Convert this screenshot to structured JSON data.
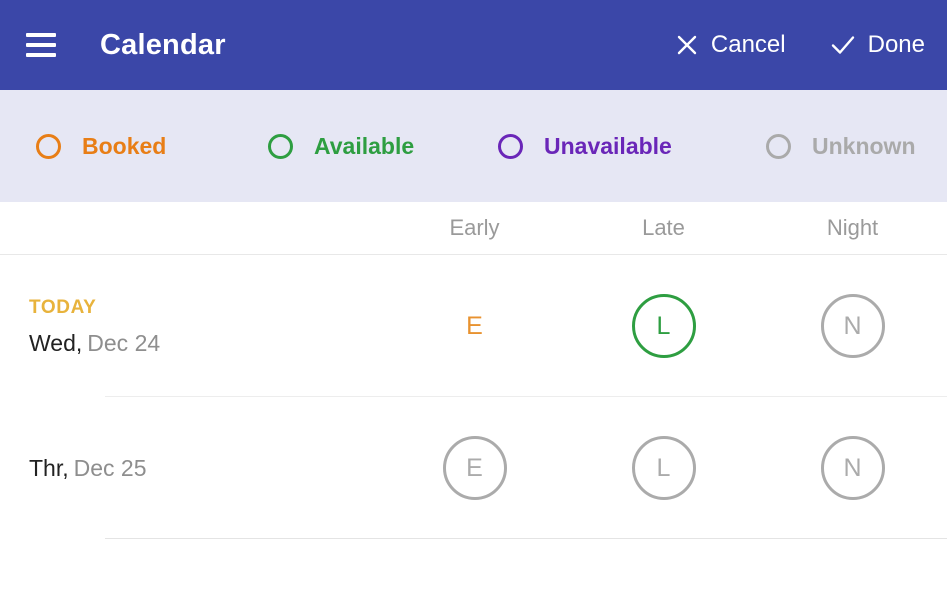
{
  "appbar": {
    "menu_icon": "hamburger-menu-icon",
    "title": "Calendar",
    "cancel": {
      "icon": "close-x-icon",
      "glyph": "✕",
      "label": "Cancel"
    },
    "done": {
      "icon": "checkmark-icon",
      "glyph": "✓",
      "label": "Done"
    },
    "background_color": "#3B47A8",
    "text_color": "#FFFFFF"
  },
  "legend": {
    "background_color": "#E6E7F4",
    "items": [
      {
        "label": "Booked",
        "color": "#E87E16",
        "icon": "status-circle-icon"
      },
      {
        "label": "Available",
        "color": "#2E9E41",
        "icon": "status-circle-icon"
      },
      {
        "label": "Unavailable",
        "color": "#6A26B8",
        "icon": "status-circle-icon"
      },
      {
        "label": "Unknown",
        "color": "#AAAAAA",
        "icon": "status-circle-icon"
      }
    ]
  },
  "columns": {
    "day_header": "",
    "shifts": [
      "Early",
      "Late",
      "Night"
    ]
  },
  "rows": [
    {
      "today_label": "TODAY",
      "dow": "Wed,",
      "date": "Dec 24",
      "shifts": [
        {
          "letter": "E",
          "status": "Booked",
          "color": "#E8922F",
          "ring": false
        },
        {
          "letter": "L",
          "status": "Available",
          "color": "#2E9E41",
          "ring": true
        },
        {
          "letter": "N",
          "status": "Unknown",
          "color": "#ABABAB",
          "ring": true
        }
      ]
    },
    {
      "today_label": "",
      "dow": "Thr,",
      "date": "Dec 25",
      "shifts": [
        {
          "letter": "E",
          "status": "Unknown",
          "color": "#ABABAB",
          "ring": true
        },
        {
          "letter": "L",
          "status": "Unknown",
          "color": "#ABABAB",
          "ring": true
        },
        {
          "letter": "N",
          "status": "Unknown",
          "color": "#ABABAB",
          "ring": true
        }
      ]
    }
  ]
}
